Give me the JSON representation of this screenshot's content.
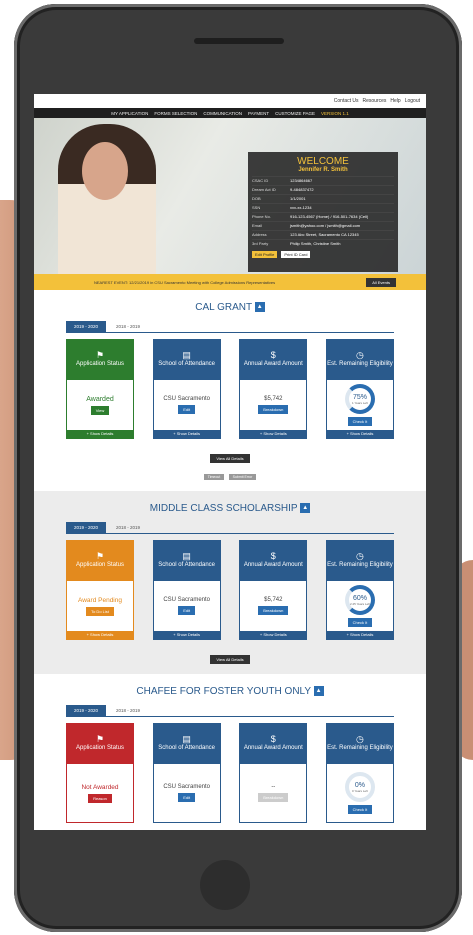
{
  "header": {
    "links": [
      "Contact Us",
      "Resources",
      "Help",
      "Logout"
    ]
  },
  "nav": {
    "items": [
      "MY APPLICATION",
      "FORMS SELECTION",
      "COMMUNICATION",
      "PAYMENT",
      "CUSTOMIZE PAGE"
    ],
    "active": "VERSION 1.1"
  },
  "welcome": {
    "title": "WELCOME",
    "name": "Jennifer R. Smith",
    "show_less": "+ Show Less",
    "rows": [
      {
        "k": "CSAC ID",
        "v": "1234864667"
      },
      {
        "k": "Dream Act ID",
        "v": "9-484837472"
      },
      {
        "k": "DOB",
        "v": "1/1/2001"
      },
      {
        "k": "SSN",
        "v": "xxx-xx-1234"
      },
      {
        "k": "Phone No.",
        "v": "916-123-4567 (Home) / 916-501-7634 (Cell)"
      },
      {
        "k": "Email",
        "v": "jsmith@yahoo.com / jsmith@gmail.com"
      },
      {
        "k": "Address",
        "v": "123 Abc Street, Sacramento CA 12345"
      },
      {
        "k": "3rd Party",
        "v": "Philip Smith, Christine Smith"
      }
    ],
    "edit": "Edit Profile",
    "print": "Print ID Card"
  },
  "event": {
    "text": "NEAREST EVENT: 12/21/2019 in CSU Sacramento Meeting with College Admissions Representatives",
    "all": "All Events"
  },
  "sections": [
    {
      "title": "CAL GRANT",
      "tabs": [
        "2019 - 2020",
        "2018 - 2019"
      ],
      "cards": {
        "app_status": "Awarded",
        "school": "CSU Sacramento",
        "amount": "$5,742",
        "pct": "75%",
        "years": "1 Years Left"
      },
      "btns": {
        "view": "View",
        "edit": "Edit",
        "breakdown": "Breakdown",
        "check": "Check It",
        "show": "+ Show Details"
      },
      "view_all": "View All Details",
      "timeout": "Timeout",
      "submit": "Submit Error"
    },
    {
      "title": "MIDDLE CLASS SCHOLARSHIP",
      "tabs": [
        "2019 - 2020",
        "2018 - 2019"
      ],
      "cards": {
        "app_status": "Award Pending",
        "school": "CSU Sacramento",
        "amount": "$5,742",
        "pct": "60%",
        "years": "2.25 Years Left"
      },
      "btns": {
        "todo": "To Do List",
        "edit": "Edit",
        "breakdown": "Breakdown",
        "check": "Check It",
        "show": "+ Show Details"
      },
      "view_all": "View All Details"
    },
    {
      "title": "CHAFEE FOR FOSTER YOUTH ONLY",
      "tabs": [
        "2019 - 2020",
        "2018 - 2019"
      ],
      "cards": {
        "app_status": "Not Awarded",
        "school": "CSU Sacramento",
        "amount": "--",
        "pct": "0%",
        "years": "0 Years Left"
      },
      "btns": {
        "reason": "Reason",
        "edit": "Edit",
        "breakdown": "Breakdown",
        "check": "Check It"
      }
    }
  ],
  "card_labels": {
    "app": "Application Status",
    "school": "School of Attendance",
    "amount": "Annual Award Amount",
    "elig": "Est. Remaining Eligibility"
  }
}
